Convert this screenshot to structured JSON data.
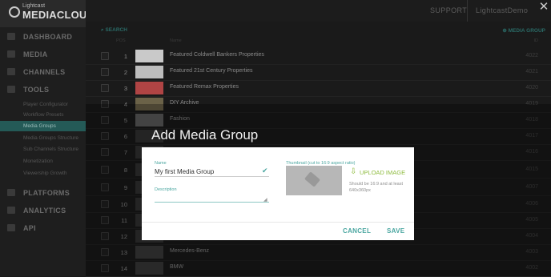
{
  "brand": {
    "small": "Lightcast",
    "big": "MEDIACLOUD"
  },
  "topbar": {
    "support": "SUPPORT",
    "account": "LightcastDemo"
  },
  "sidebar": {
    "items": [
      {
        "label": "DASHBOARD",
        "icon": "dashboard-icon"
      },
      {
        "label": "MEDIA",
        "icon": "media-icon"
      },
      {
        "label": "CHANNELS",
        "icon": "channels-icon"
      },
      {
        "label": "TOOLS",
        "icon": "tools-icon"
      },
      {
        "label": "PLATFORMS",
        "icon": "platforms-icon"
      },
      {
        "label": "ANALYTICS",
        "icon": "analytics-icon"
      },
      {
        "label": "API",
        "icon": "api-icon"
      }
    ],
    "tools_sub": [
      "Player Configurator",
      "Workflow Presets",
      "Media Groups",
      "Media Groups Structure",
      "Sub Channels Structure",
      "Monetization",
      "Viewership Growth"
    ],
    "active_sub": "Media Groups"
  },
  "toolbar": {
    "search": "SEARCH",
    "add": "MEDIA GROUP"
  },
  "columns": {
    "pos": "POS",
    "name": "Name",
    "id": "ID"
  },
  "rows": [
    {
      "num": "1",
      "name": "Featured Coldwell Bankers Properties",
      "id": "4022"
    },
    {
      "num": "2",
      "name": "Featured 21st Century Properties",
      "id": "4021"
    },
    {
      "num": "3",
      "name": "Featured Remax Properties",
      "id": "4020"
    },
    {
      "num": "4",
      "name": "DIY Archive",
      "id": "4019"
    },
    {
      "num": "5",
      "name": "Fashion",
      "id": "4018"
    },
    {
      "num": "6",
      "name": "",
      "id": "4017"
    },
    {
      "num": "7",
      "name": "",
      "id": "4016"
    },
    {
      "num": "8",
      "name": "",
      "id": "4015"
    },
    {
      "num": "9",
      "name": "",
      "id": "4007"
    },
    {
      "num": "10",
      "name": "",
      "id": "4006"
    },
    {
      "num": "11",
      "name": "",
      "id": "4005"
    },
    {
      "num": "12",
      "name": "",
      "id": "4004"
    },
    {
      "num": "13",
      "name": "Mercedes-Benz",
      "id": "4003"
    },
    {
      "num": "14",
      "name": "BMW",
      "id": "4002"
    }
  ],
  "modal": {
    "title": "Add Media Group",
    "name_label": "Name",
    "name_value": "My first Media Group",
    "description_label": "Description",
    "thumbnail_label": "Thumbnail (cut to 16:9 aspect ratio)",
    "upload_label": "UPLOAD IMAGE",
    "help_text": "Should be 16:9 and at least 640x360px",
    "cancel": "CANCEL",
    "save": "SAVE"
  },
  "colors": {
    "accent": "#4aa6a0",
    "upload": "#8dbb3d",
    "active_nav": "#245a57"
  }
}
